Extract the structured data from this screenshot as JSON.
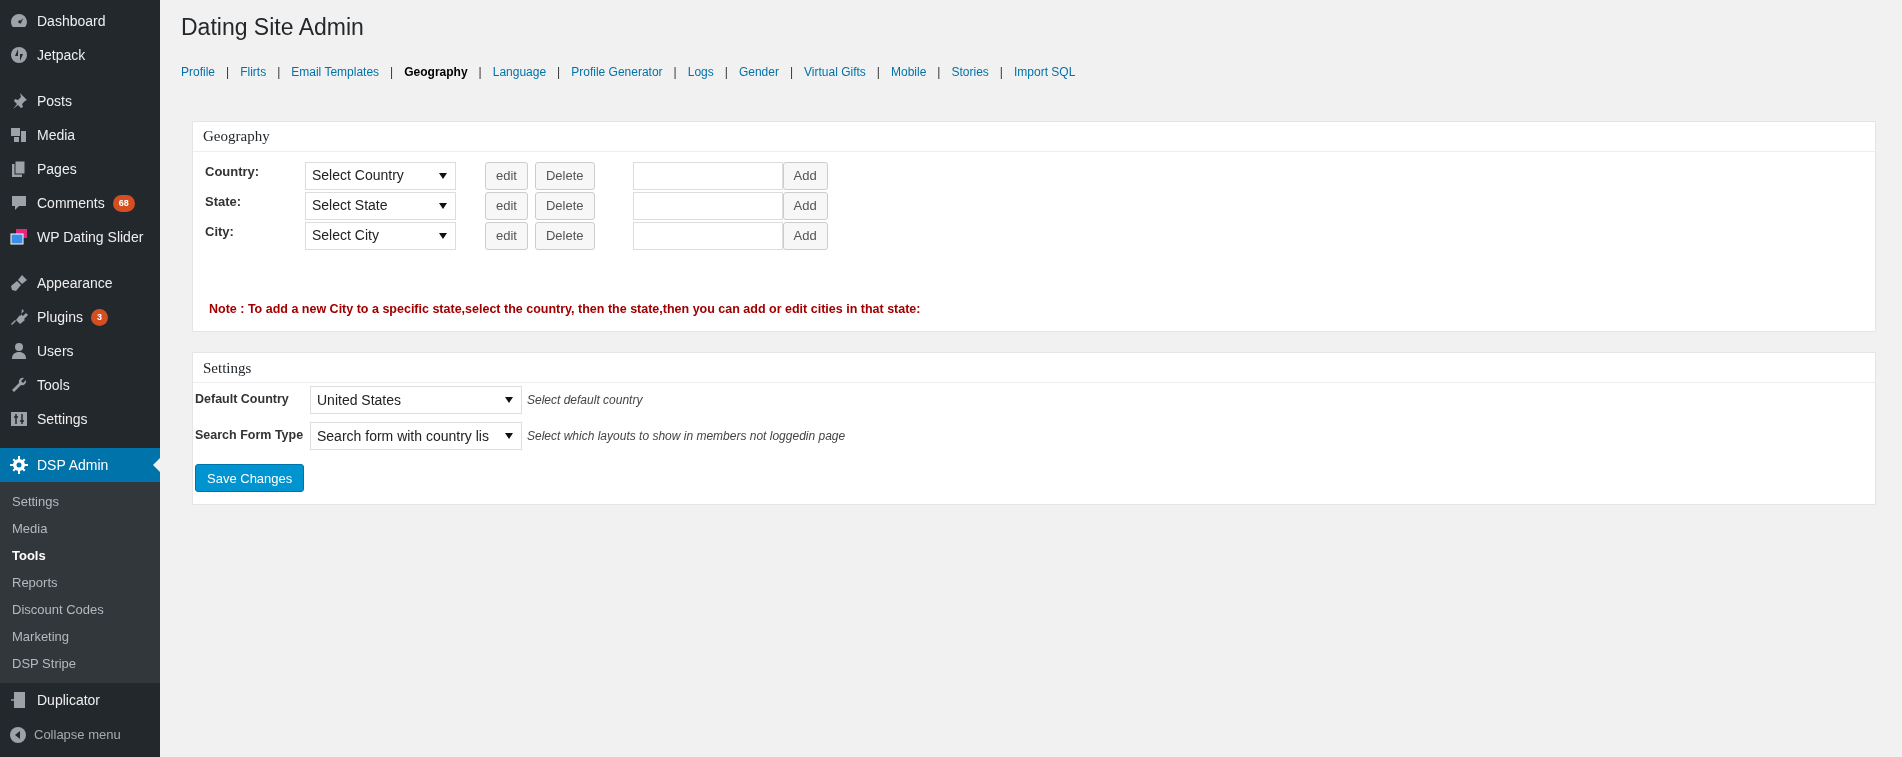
{
  "sidebar": {
    "groups": [
      [
        {
          "label": "Dashboard",
          "selected": false
        },
        {
          "label": "Jetpack",
          "selected": false
        }
      ],
      [
        {
          "label": "Posts",
          "selected": false
        },
        {
          "label": "Media",
          "selected": false
        },
        {
          "label": "Pages",
          "selected": false
        },
        {
          "label": "Comments",
          "badge": "68",
          "selected": false
        },
        {
          "label": "WP Dating Slider",
          "selected": false
        }
      ],
      [
        {
          "label": "Appearance",
          "selected": false
        },
        {
          "label": "Plugins",
          "badge": "3",
          "selected": false
        },
        {
          "label": "Users",
          "selected": false
        },
        {
          "label": "Tools",
          "selected": false
        },
        {
          "label": "Settings",
          "selected": false
        }
      ],
      [
        {
          "label": "DSP Admin",
          "selected": true,
          "submenu": [
            {
              "label": "Settings",
              "selected": false
            },
            {
              "label": "Media",
              "selected": false
            },
            {
              "label": "Tools",
              "selected": true
            },
            {
              "label": "Reports",
              "selected": false
            },
            {
              "label": "Discount Codes",
              "selected": false
            },
            {
              "label": "Marketing",
              "selected": false
            },
            {
              "label": "DSP Stripe",
              "selected": false
            }
          ]
        },
        {
          "label": "Duplicator",
          "selected": false
        }
      ]
    ],
    "collapse": "Collapse menu"
  },
  "page_title": "Dating Site Admin",
  "nav": [
    {
      "kind": "link",
      "label": "Profile",
      "selected": false
    },
    {
      "kind": "separator",
      "label": "|"
    },
    {
      "kind": "link",
      "label": "Flirts",
      "selected": false
    },
    {
      "kind": "separator",
      "label": "|"
    },
    {
      "kind": "link",
      "label": "Email Templates",
      "selected": false
    },
    {
      "kind": "separator",
      "label": "|"
    },
    {
      "kind": "link",
      "label": "Geography",
      "selected": true
    },
    {
      "kind": "separator",
      "label": "|"
    },
    {
      "kind": "link",
      "label": "Language",
      "selected": false
    },
    {
      "kind": "separator",
      "label": "|"
    },
    {
      "kind": "link",
      "label": "Profile Generator",
      "selected": false
    },
    {
      "kind": "separator",
      "label": "|"
    },
    {
      "kind": "link",
      "label": "Logs",
      "selected": false
    },
    {
      "kind": "separator",
      "label": "|"
    },
    {
      "kind": "link",
      "label": "Gender",
      "selected": false
    },
    {
      "kind": "separator",
      "label": "|"
    },
    {
      "kind": "link",
      "label": "Virtual Gifts",
      "selected": false
    },
    {
      "kind": "separator",
      "label": "|"
    },
    {
      "kind": "link",
      "label": "Mobile",
      "selected": false
    },
    {
      "kind": "separator",
      "label": "|"
    },
    {
      "kind": "link",
      "label": "Stories",
      "selected": false
    },
    {
      "kind": "separator",
      "label": "|"
    },
    {
      "kind": "link",
      "label": "Import SQL",
      "selected": false
    }
  ],
  "geography": {
    "title": "Geography",
    "rows": [
      {
        "label": "Country:",
        "select": "Select Country",
        "edit": "edit",
        "delete": "Delete",
        "add": "Add"
      },
      {
        "label": "State:",
        "select": "Select State",
        "edit": "edit",
        "delete": "Delete",
        "add": "Add"
      },
      {
        "label": "City:",
        "select": "Select City",
        "edit": "edit",
        "delete": "Delete",
        "add": "Add"
      }
    ],
    "note": "Note : To add a new City to a specific state,select the country, then the state,then you can add or edit cities in that state:"
  },
  "settings": {
    "title": "Settings",
    "rows": [
      {
        "label": "Default Country",
        "select": "United States",
        "hint": "Select default country"
      },
      {
        "label": "Search Form Type",
        "select": "Search form with country lis",
        "hint": "Select which layouts to show in members not loggedin page"
      }
    ],
    "save": "Save Changes"
  }
}
